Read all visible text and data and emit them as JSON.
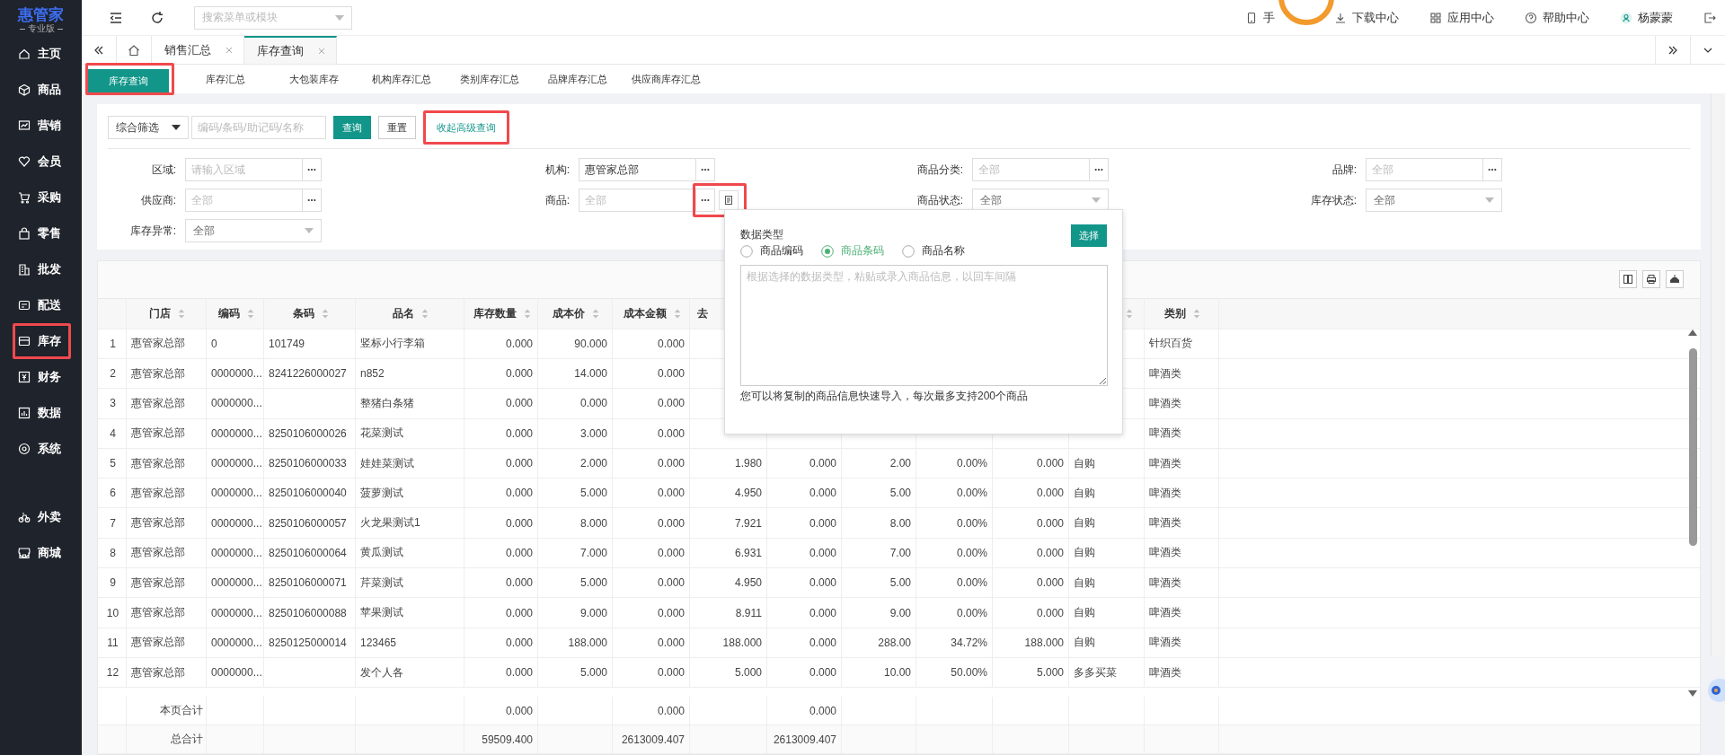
{
  "sidebar": {
    "logo": {
      "name": "惠管家",
      "edition": "专业版"
    },
    "items": [
      {
        "label": "主页",
        "highlighted": false
      },
      {
        "label": "商品",
        "highlighted": false
      },
      {
        "label": "营销",
        "highlighted": false
      },
      {
        "label": "会员",
        "highlighted": false
      },
      {
        "label": "采购",
        "highlighted": false
      },
      {
        "label": "零售",
        "highlighted": false
      },
      {
        "label": "批发",
        "highlighted": false
      },
      {
        "label": "配送",
        "highlighted": false
      },
      {
        "label": "库存",
        "highlighted": true
      },
      {
        "label": "财务",
        "highlighted": false
      },
      {
        "label": "数据",
        "highlighted": false
      },
      {
        "label": "系统",
        "highlighted": false
      }
    ],
    "bottom_items": [
      {
        "label": "外卖",
        "highlighted": false
      },
      {
        "label": "商城",
        "highlighted": false
      }
    ]
  },
  "topbar": {
    "search": {
      "placeholder": "搜索菜单或模块"
    },
    "links": [
      {
        "kind": "phone",
        "label": "手"
      },
      {
        "kind": "download",
        "label": "下载中心"
      },
      {
        "kind": "apps",
        "label": "应用中心"
      },
      {
        "kind": "help",
        "label": "帮助中心"
      },
      {
        "kind": "user",
        "label": "杨蒙蒙"
      }
    ]
  },
  "tabs": [
    {
      "label": "销售汇总",
      "selected": false
    },
    {
      "label": "库存查询",
      "selected": true
    }
  ],
  "subtabs": [
    {
      "label": "库存查询",
      "selected": true,
      "highlighted": true
    },
    {
      "label": "库存汇总",
      "selected": false,
      "highlighted": false
    },
    {
      "label": "大包装库存",
      "selected": false,
      "highlighted": false
    },
    {
      "label": "机构库存汇总",
      "selected": false,
      "highlighted": false
    },
    {
      "label": "类别库存汇总",
      "selected": false,
      "highlighted": false
    },
    {
      "label": "品牌库存汇总",
      "selected": false,
      "highlighted": false
    },
    {
      "label": "供应商库存汇总",
      "selected": false,
      "highlighted": false
    }
  ],
  "quick_filter": {
    "mode": "综合筛选",
    "placeholder": "编码/条码/助记码/名称",
    "query_button": "查询",
    "reset_button": "重置",
    "advanced_link": "收起高级查询",
    "advanced_highlighted": true
  },
  "filters": [
    {
      "label": "区域:",
      "kind": "picker",
      "placeholder": "请输入区域",
      "highlighted": false
    },
    {
      "label": "机构:",
      "kind": "picker",
      "value": "惠管家总部",
      "highlighted": false
    },
    {
      "label": "商品分类:",
      "kind": "picker",
      "placeholder": "全部",
      "highlighted": false
    },
    {
      "label": "品牌:",
      "kind": "picker",
      "placeholder": "全部",
      "highlighted": false
    },
    {
      "label": "供应商:",
      "kind": "picker",
      "placeholder": "全部",
      "highlighted": false
    },
    {
      "label": "商品:",
      "kind": "paste",
      "placeholder": "全部",
      "highlighted": true
    },
    {
      "label": "商品状态:",
      "kind": "select",
      "value": "全部"
    },
    {
      "label": "库存状态:",
      "kind": "select",
      "value": "全部"
    },
    {
      "label": "库存异常:",
      "kind": "select",
      "value": "全部"
    }
  ],
  "paste_popup": {
    "title": "数据类型",
    "button": "选择",
    "options": [
      {
        "label": "商品编码",
        "selected": false
      },
      {
        "label": "商品条码",
        "selected": true
      },
      {
        "label": "商品名称",
        "selected": false
      }
    ],
    "placeholder": "根据选择的数据类型，粘贴或录入商品信息，以回车间隔",
    "note": "您可以将复制的商品信息快速导入，每次最多支持200个商品"
  },
  "table": {
    "columns": [
      {
        "label": "门店",
        "kind": "text",
        "sortable": true
      },
      {
        "label": "编码",
        "kind": "text",
        "sortable": true
      },
      {
        "label": "条码",
        "kind": "text",
        "sortable": true
      },
      {
        "label": "品名",
        "kind": "text",
        "sortable": true
      },
      {
        "label": "库存数量",
        "kind": "number",
        "sortable": true
      },
      {
        "label": "成本价",
        "kind": "number",
        "sortable": true
      },
      {
        "label": "成本金额",
        "kind": "number",
        "sortable": true
      },
      {
        "label": "去",
        "kind": "number"
      },
      {
        "kind": "number"
      },
      {
        "kind": "number"
      },
      {
        "kind": "number"
      },
      {
        "kind": "number"
      },
      {
        "kind": "text",
        "sortable": true
      },
      {
        "label": "类别",
        "kind": "text",
        "sortable": true
      }
    ],
    "rows": [
      {
        "index": "1",
        "cells": [
          "惠管家总部",
          "0",
          "101749",
          "竖标小行李箱",
          "0.000",
          "90.000",
          "0.000",
          null,
          null,
          null,
          null,
          null,
          null,
          "针织百货"
        ]
      },
      {
        "index": "2",
        "cells": [
          "惠管家总部",
          "0000000...",
          "8241226000027",
          "n852",
          "0.000",
          "14.000",
          "0.000",
          null,
          null,
          null,
          null,
          null,
          null,
          "啤酒类"
        ]
      },
      {
        "index": "3",
        "cells": [
          "惠管家总部",
          "0000000...",
          null,
          "整猪白条猪",
          "0.000",
          "0.000",
          "0.000",
          null,
          null,
          null,
          null,
          null,
          null,
          "啤酒类"
        ]
      },
      {
        "index": "4",
        "cells": [
          "惠管家总部",
          "0000000...",
          "8250106000026",
          "花菜测试",
          "0.000",
          "3.000",
          "0.000",
          null,
          null,
          null,
          null,
          null,
          null,
          "啤酒类"
        ]
      },
      {
        "index": "5",
        "cells": [
          "惠管家总部",
          "0000000...",
          "8250106000033",
          "娃娃菜测试",
          "0.000",
          "2.000",
          "0.000",
          "1.980",
          "0.000",
          "2.00",
          "0.00%",
          "0.000",
          "自购",
          "啤酒类"
        ]
      },
      {
        "index": "6",
        "cells": [
          "惠管家总部",
          "0000000...",
          "8250106000040",
          "菠萝测试",
          "0.000",
          "5.000",
          "0.000",
          "4.950",
          "0.000",
          "5.00",
          "0.00%",
          "0.000",
          "自购",
          "啤酒类"
        ]
      },
      {
        "index": "7",
        "cells": [
          "惠管家总部",
          "0000000...",
          "8250106000057",
          "火龙果测试1",
          "0.000",
          "8.000",
          "0.000",
          "7.921",
          "0.000",
          "8.00",
          "0.00%",
          "0.000",
          "自购",
          "啤酒类"
        ]
      },
      {
        "index": "8",
        "cells": [
          "惠管家总部",
          "0000000...",
          "8250106000064",
          "黄瓜测试",
          "0.000",
          "7.000",
          "0.000",
          "6.931",
          "0.000",
          "7.00",
          "0.00%",
          "0.000",
          "自购",
          "啤酒类"
        ]
      },
      {
        "index": "9",
        "cells": [
          "惠管家总部",
          "0000000...",
          "8250106000071",
          "芹菜测试",
          "0.000",
          "5.000",
          "0.000",
          "4.950",
          "0.000",
          "5.00",
          "0.00%",
          "0.000",
          "自购",
          "啤酒类"
        ]
      },
      {
        "index": "10",
        "cells": [
          "惠管家总部",
          "0000000...",
          "8250106000088",
          "苹果测试",
          "0.000",
          "9.000",
          "0.000",
          "8.911",
          "0.000",
          "9.00",
          "0.00%",
          "0.000",
          "自购",
          "啤酒类"
        ]
      },
      {
        "index": "11",
        "cells": [
          "惠管家总部",
          "0000000...",
          "8250125000014",
          "123465",
          "0.000",
          "188.000",
          "0.000",
          "188.000",
          "0.000",
          "288.00",
          "34.72%",
          "188.000",
          "自购",
          "啤酒类"
        ]
      },
      {
        "index": "12",
        "cells": [
          "惠管家总部",
          "0000000...",
          null,
          "发个人各",
          "0.000",
          "5.000",
          "0.000",
          "5.000",
          "0.000",
          "10.00",
          "50.00%",
          "5.000",
          "多多买菜",
          "啤酒类"
        ]
      }
    ],
    "totals": [
      {
        "label": "本页合计",
        "cells": [
          null,
          null,
          null,
          "0.000",
          null,
          "0.000",
          null,
          "0.000",
          null,
          null,
          null,
          null,
          null
        ]
      },
      {
        "label": "总合计",
        "cells": [
          null,
          null,
          null,
          "59509.400",
          null,
          "2613009.407",
          null,
          "2613009.407",
          null,
          null,
          null,
          null,
          null
        ]
      }
    ]
  }
}
